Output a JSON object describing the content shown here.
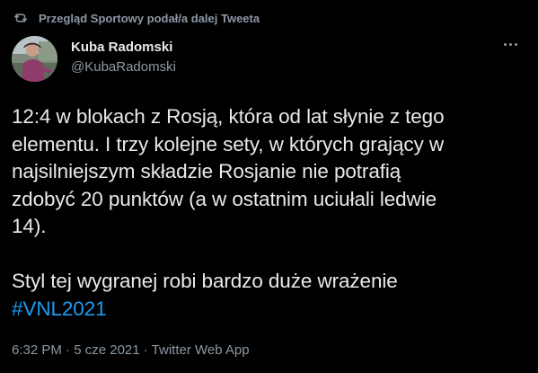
{
  "retweet": {
    "icon": "retweet-icon",
    "text": "Przegląd Sportowy podał/a dalej Tweeta"
  },
  "author": {
    "name": "Kuba Radomski",
    "handle": "@KubaRadomski",
    "avatar_icon": "profile-photo"
  },
  "more_menu": {
    "icon": "more-dots-icon"
  },
  "tweet": {
    "lines": [
      "12:4 w blokach z Rosją, która od lat słynie z tego",
      "elementu. I trzy kolejne sety, w których grający w",
      "najsilniejszym składzie Rosjanie nie potrafią",
      "zdobyć 20 punktów (a w ostatnim uciułali ledwie",
      "14)."
    ],
    "line2": "Styl tej wygranej robi bardzo duże wrażenie",
    "hashtag": "#VNL2021"
  },
  "meta": {
    "time": "6:32 PM",
    "separator1": " · ",
    "date": "5 cze 2021",
    "separator2": " · ",
    "source": "Twitter Web App"
  },
  "colors": {
    "background": "#000000",
    "text": "#e7e9ea",
    "secondary": "#8b98a5",
    "accent": "#1d9bf0"
  }
}
